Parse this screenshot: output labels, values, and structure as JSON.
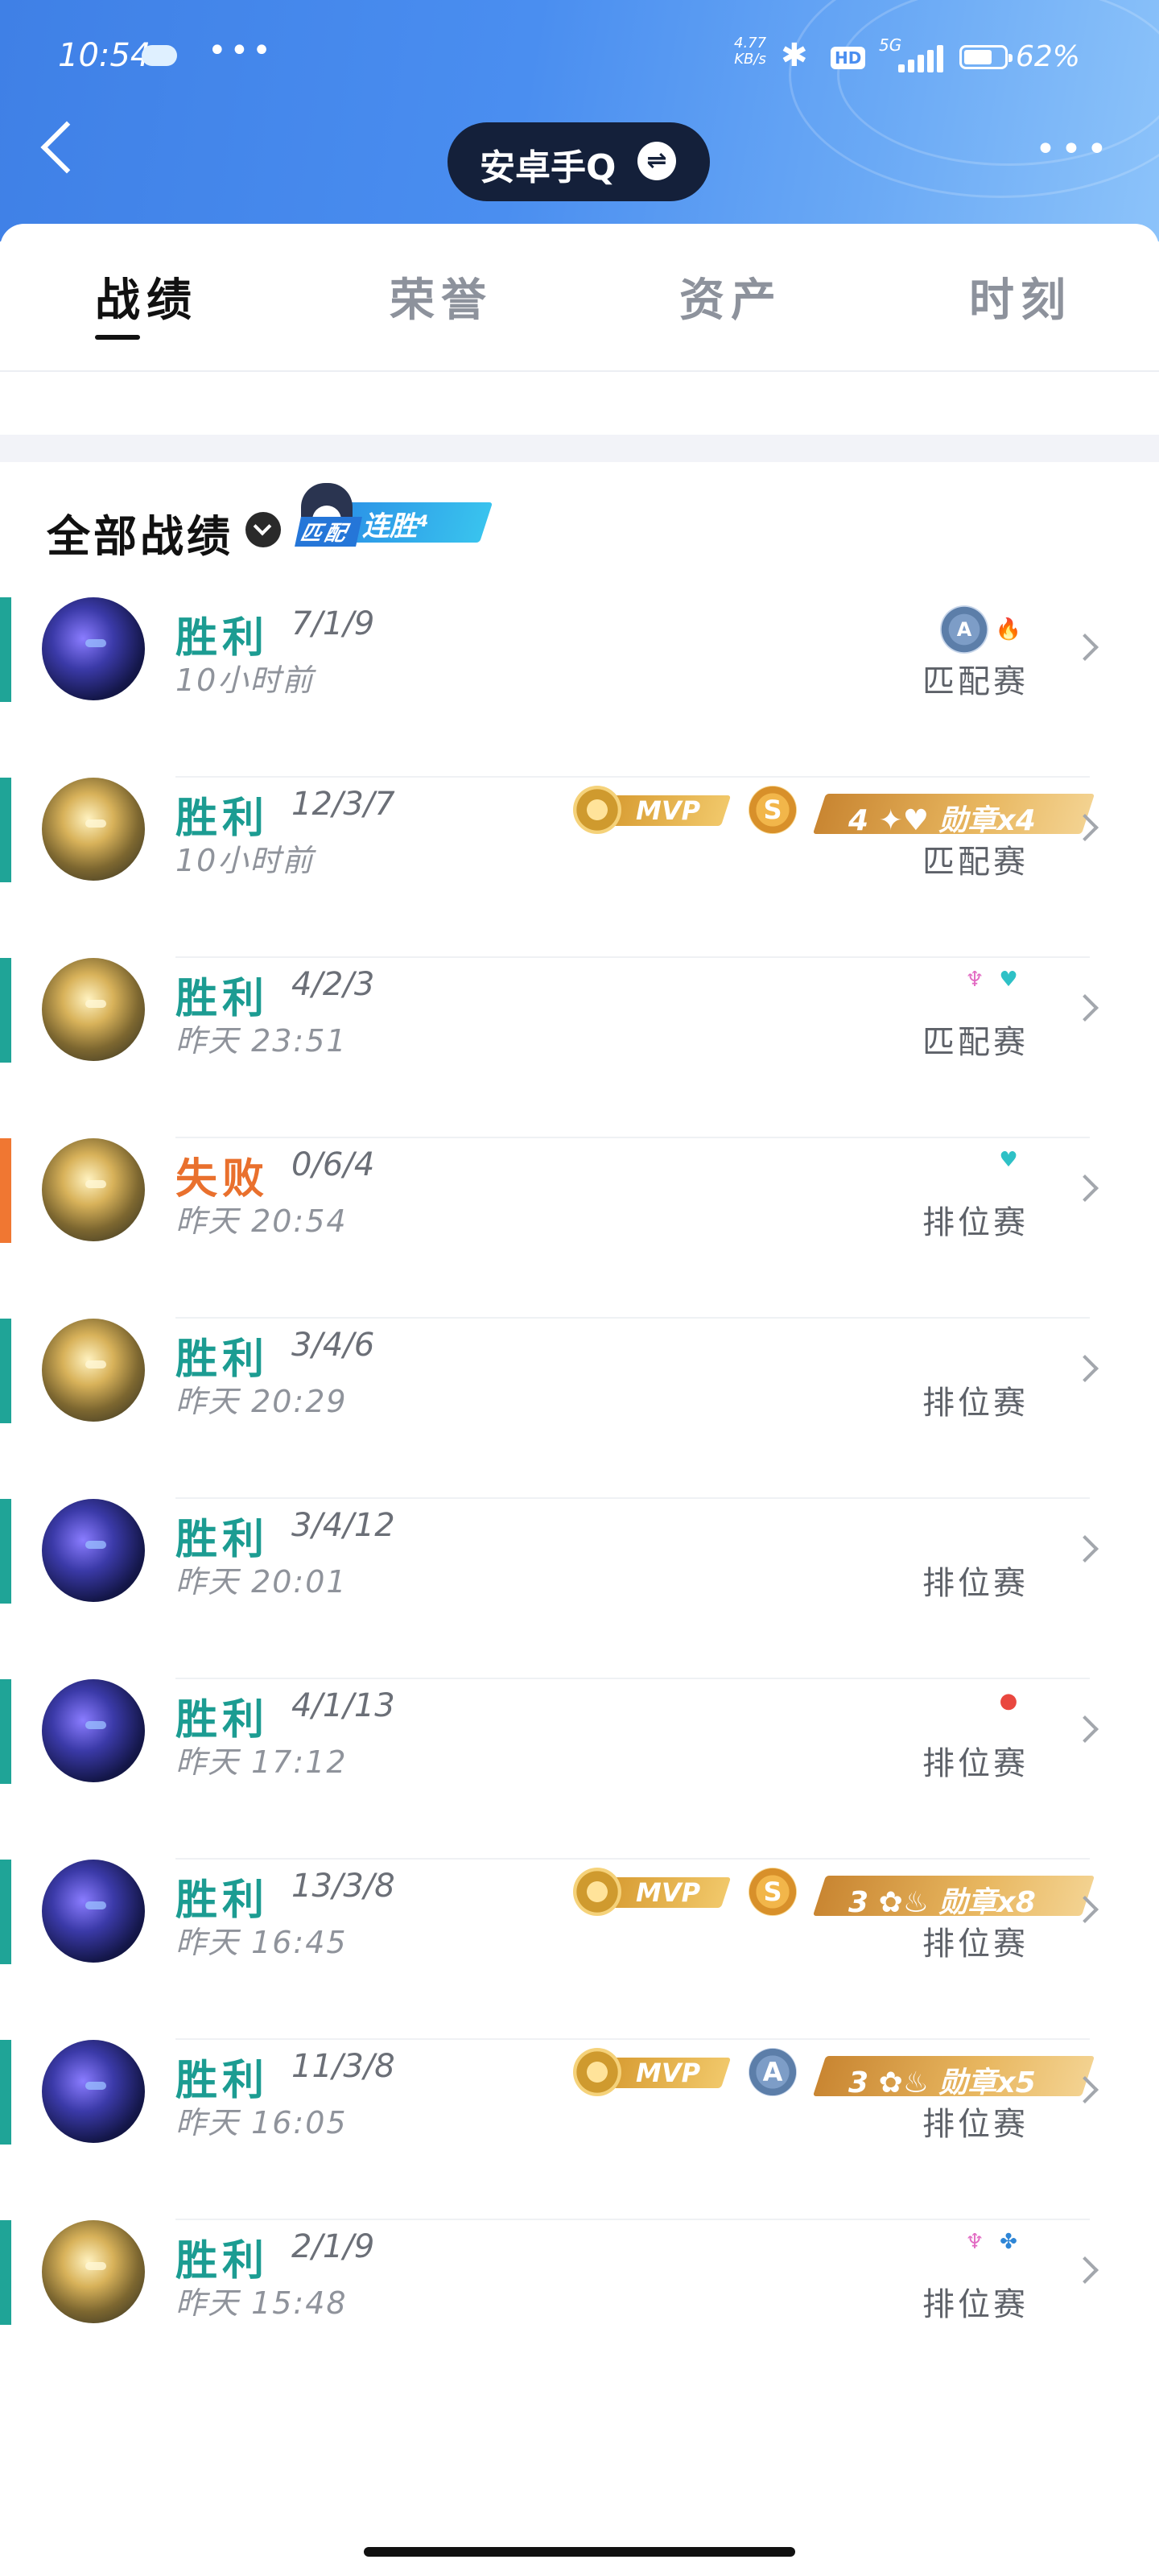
{
  "status_bar": {
    "time": "10:54",
    "more": "•••",
    "net_speed_value": "4.77",
    "net_speed_unit": "KB/s",
    "hd": "HD",
    "network": "5G",
    "battery": "62%"
  },
  "header": {
    "title": "安卓手Q",
    "more": "•••",
    "switch_icon": "⇌"
  },
  "tabs": [
    {
      "label": "战绩",
      "active": true
    },
    {
      "label": "荣誉",
      "active": false
    },
    {
      "label": "资产",
      "active": false
    },
    {
      "label": "时刻",
      "active": false
    }
  ],
  "filter": {
    "label": "全部战绩",
    "streak_mode": "匹配",
    "streak_label": "连胜⁴"
  },
  "matches": [
    {
      "result": "胜利",
      "kda": "7/1/9",
      "time": "10小时前",
      "mode": "匹配赛",
      "outcome": "win",
      "hero": "a",
      "icons": [
        "a-badge",
        "fire"
      ]
    },
    {
      "result": "胜利",
      "kda": "12/3/7",
      "time": "10小时前",
      "mode": "匹配赛",
      "outcome": "win",
      "hero": "b",
      "mvp": "MVP",
      "grade": "S",
      "grade_style": "gold",
      "medal": "4 ✦♥ 勋章x4"
    },
    {
      "result": "胜利",
      "kda": "4/2/3",
      "time": "昨天 23:51",
      "mode": "匹配赛",
      "outcome": "win",
      "hero": "b",
      "icons": [
        "lotus",
        "heart"
      ]
    },
    {
      "result": "失败",
      "kda": "0/6/4",
      "time": "昨天 20:54",
      "mode": "排位赛",
      "outcome": "loss",
      "hero": "b",
      "icons": [
        "heart"
      ]
    },
    {
      "result": "胜利",
      "kda": "3/4/6",
      "time": "昨天 20:29",
      "mode": "排位赛",
      "outcome": "win",
      "hero": "b"
    },
    {
      "result": "胜利",
      "kda": "3/4/12",
      "time": "昨天 20:01",
      "mode": "排位赛",
      "outcome": "win",
      "hero": "a"
    },
    {
      "result": "胜利",
      "kda": "4/1/13",
      "time": "昨天 17:12",
      "mode": "排位赛",
      "outcome": "win",
      "hero": "a",
      "icons": [
        "drop"
      ]
    },
    {
      "result": "胜利",
      "kda": "13/3/8",
      "time": "昨天 16:45",
      "mode": "排位赛",
      "outcome": "win",
      "hero": "a",
      "mvp": "MVP",
      "grade": "S",
      "grade_style": "gold",
      "medal": "3 ✿♨ 勋章x8"
    },
    {
      "result": "胜利",
      "kda": "11/3/8",
      "time": "昨天 16:05",
      "mode": "排位赛",
      "outcome": "win",
      "hero": "a",
      "mvp": "MVP",
      "grade": "A",
      "grade_style": "silver",
      "medal": "3 ✿♨ 勋章x5"
    },
    {
      "result": "胜利",
      "kda": "2/1/9",
      "time": "昨天 15:48",
      "mode": "排位赛",
      "outcome": "win",
      "hero": "b",
      "icons": [
        "lotus",
        "leaf"
      ]
    }
  ],
  "icon_glyphs": {
    "fire": "🔥",
    "lotus": "♆",
    "heart": "♥",
    "drop": "●",
    "leaf": "✤",
    "a-badge": "A"
  },
  "colors": {
    "win": "#1fa497",
    "loss": "#f07732",
    "header_blue": "#4a8ef0"
  }
}
